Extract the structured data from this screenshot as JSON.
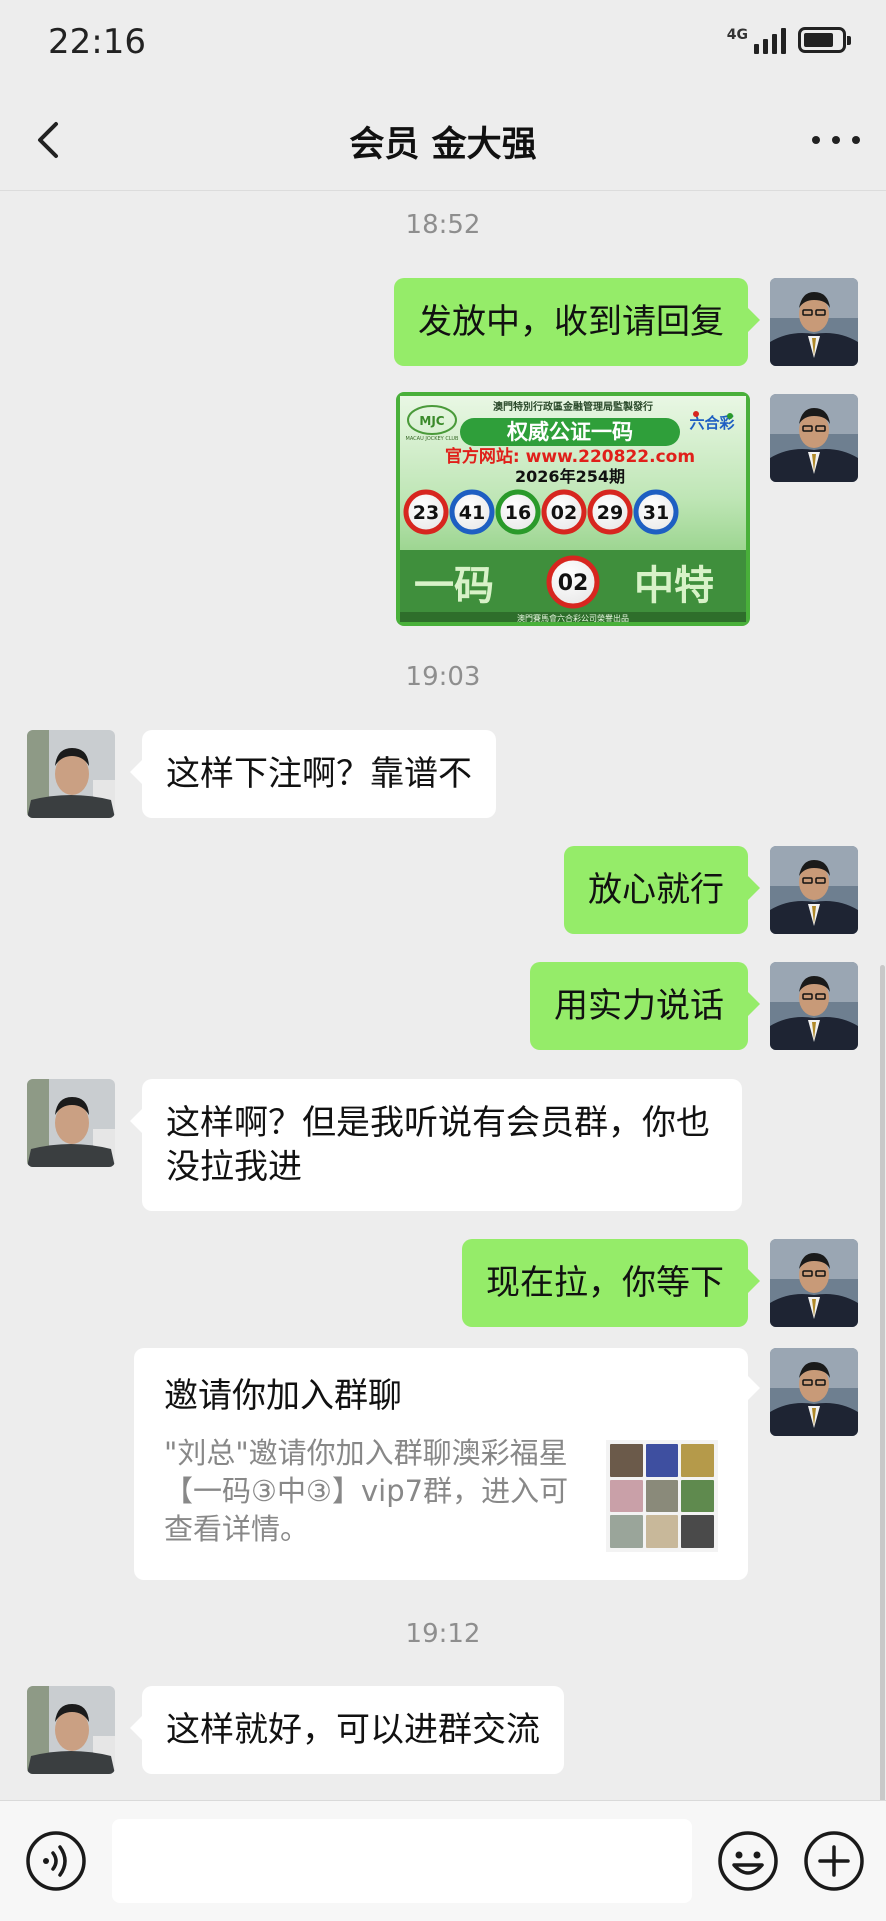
{
  "status_bar": {
    "time": "22:16",
    "network": "4G",
    "battery_level": 0.8
  },
  "header": {
    "title": "会员 金大强"
  },
  "messages": {
    "t1": "18:52",
    "m1": "发放中，收到请回复",
    "lottery": {
      "top_line": "澳門特別行政區金融管理局監製發行",
      "logo_text": "MACAU JOCKEY CLUB",
      "logo_cn": "澳門賽馬會",
      "brand": "六合彩",
      "title": "权威公证一码",
      "website": "官方网站: www.220822.com",
      "issue": "2026年254期",
      "balls": [
        "23",
        "41",
        "16",
        "02",
        "29",
        "31"
      ],
      "ball_colors": [
        "#d7261f",
        "#1e5fc2",
        "#2a9a2a",
        "#d7261f",
        "#d7261f",
        "#1e5fc2"
      ],
      "left_word": "一码",
      "special": "02",
      "right_word": "中特",
      "bottom_line": "澳門賽馬會六合彩公司榮譽出品"
    },
    "t2": "19:03",
    "m2": "这样下注啊？靠谱不",
    "m3": "放心就行",
    "m4": "用实力说话",
    "m5": "这样啊？但是我听说有会员群，你也没拉我进",
    "m6": "现在拉，你等下",
    "invite": {
      "title": "邀请你加入群聊",
      "desc": "\"刘总\"邀请你加入群聊澳彩福星【一码③中③】vip7群，进入可查看详情。"
    },
    "t3": "19:12",
    "m7": "这样就好，可以进群交流"
  },
  "input": {
    "placeholder": ""
  },
  "colors": {
    "outgoing_bubble": "#95ec69",
    "incoming_bubble": "#ffffff",
    "background": "#ededed"
  }
}
